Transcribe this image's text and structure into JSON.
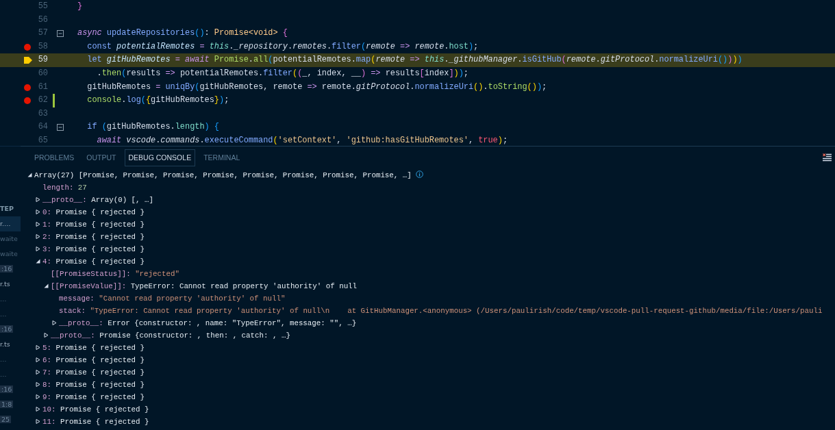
{
  "editor": {
    "lines": [
      {
        "number": "55",
        "breakpoint": false,
        "current_frame": false,
        "modified": false,
        "code": [
          {
            "text": "}",
            "kind": "b2"
          }
        ]
      },
      {
        "number": "56",
        "breakpoint": false,
        "current_frame": false,
        "modified": false
      },
      {
        "number": "57",
        "breakpoint": false,
        "current_frame": false,
        "modified": false,
        "fold": true,
        "code": [
          {
            "text": "async ",
            "kind": "kw"
          },
          {
            "text": "updateRepositories",
            "kind": "fn"
          },
          {
            "text": "()",
            "kind": "b3"
          },
          {
            "text": ": ",
            "kind": "plain"
          },
          {
            "text": "Promise<void> ",
            "kind": "type"
          },
          {
            "text": "{",
            "kind": "b2"
          }
        ]
      },
      {
        "number": "58",
        "breakpoint": true,
        "current_frame": false,
        "modified": false,
        "code": [
          {
            "text": "  const ",
            "kind": "decl"
          },
          {
            "text": "potentialRemotes",
            "kind": "var"
          },
          {
            "text": " = ",
            "kind": "op"
          },
          {
            "text": "this",
            "kind": "this"
          },
          {
            "text": ".",
            "kind": "plain"
          },
          {
            "text": "_repository",
            "kind": "prop"
          },
          {
            "text": ".",
            "kind": "plain"
          },
          {
            "text": "remotes",
            "kind": "prop"
          },
          {
            "text": ".",
            "kind": "plain"
          },
          {
            "text": "filter",
            "kind": "fn"
          },
          {
            "text": "(",
            "kind": "b3"
          },
          {
            "text": "remote",
            "kind": "prop"
          },
          {
            "text": " => ",
            "kind": "op"
          },
          {
            "text": "remote",
            "kind": "prop"
          },
          {
            "text": ".",
            "kind": "plain"
          },
          {
            "text": "host",
            "kind": "teal"
          },
          {
            "text": ")",
            "kind": "b3"
          },
          {
            "text": ";",
            "kind": "plain"
          }
        ]
      },
      {
        "number": "59",
        "breakpoint": false,
        "current_frame": true,
        "modified": false,
        "code": [
          {
            "text": "  let ",
            "kind": "decl"
          },
          {
            "text": "gitHubRemotes",
            "kind": "var"
          },
          {
            "text": " = ",
            "kind": "op"
          },
          {
            "text": "await ",
            "kind": "kw"
          },
          {
            "text": "Promise",
            "kind": "green"
          },
          {
            "text": ".",
            "kind": "plain"
          },
          {
            "text": "all",
            "kind": "green"
          },
          {
            "text": "(",
            "kind": "b3"
          },
          {
            "text": "potentialRemotes.",
            "kind": "plain"
          },
          {
            "text": "map",
            "kind": "fn"
          },
          {
            "text": "(",
            "kind": "b1"
          },
          {
            "text": "remote",
            "kind": "prop"
          },
          {
            "text": " => ",
            "kind": "op"
          },
          {
            "text": "this",
            "kind": "this"
          },
          {
            "text": ".",
            "kind": "plain"
          },
          {
            "text": "_githubManager",
            "kind": "prop"
          },
          {
            "text": ".",
            "kind": "plain"
          },
          {
            "text": "isGitHub",
            "kind": "fn"
          },
          {
            "text": "(",
            "kind": "b2"
          },
          {
            "text": "remote",
            "kind": "prop"
          },
          {
            "text": ".",
            "kind": "plain"
          },
          {
            "text": "gitProtocol",
            "kind": "prop"
          },
          {
            "text": ".",
            "kind": "plain"
          },
          {
            "text": "normalizeUri",
            "kind": "fn"
          },
          {
            "text": "()",
            "kind": "b3"
          },
          {
            "text": ")",
            "kind": "b2"
          },
          {
            "text": ")",
            "kind": "b1"
          },
          {
            "text": ")",
            "kind": "b3"
          }
        ]
      },
      {
        "number": "60",
        "breakpoint": false,
        "current_frame": false,
        "modified": false,
        "code": [
          {
            "text": "    .",
            "kind": "plain"
          },
          {
            "text": "then",
            "kind": "green"
          },
          {
            "text": "(",
            "kind": "b3"
          },
          {
            "text": "results",
            "kind": "plain"
          },
          {
            "text": " => ",
            "kind": "op"
          },
          {
            "text": "potentialRemotes.",
            "kind": "plain"
          },
          {
            "text": "filter",
            "kind": "fn"
          },
          {
            "text": "(",
            "kind": "b1"
          },
          {
            "text": "(",
            "kind": "b2"
          },
          {
            "text": "_, index, __",
            "kind": "plain"
          },
          {
            "text": ")",
            "kind": "b2"
          },
          {
            "text": " => ",
            "kind": "op"
          },
          {
            "text": "results",
            "kind": "plain"
          },
          {
            "text": "[",
            "kind": "b2"
          },
          {
            "text": "index",
            "kind": "plain"
          },
          {
            "text": "]",
            "kind": "b2"
          },
          {
            "text": ")",
            "kind": "b1"
          },
          {
            "text": ")",
            "kind": "b3"
          },
          {
            "text": ";",
            "kind": "plain"
          }
        ]
      },
      {
        "number": "61",
        "breakpoint": true,
        "current_frame": false,
        "modified": false,
        "code": [
          {
            "text": "  gitHubRemotes",
            "kind": "plain"
          },
          {
            "text": " = ",
            "kind": "op"
          },
          {
            "text": "uniqBy",
            "kind": "fn"
          },
          {
            "text": "(",
            "kind": "b3"
          },
          {
            "text": "gitHubRemotes, remote",
            "kind": "plain"
          },
          {
            "text": " => ",
            "kind": "op"
          },
          {
            "text": "remote.",
            "kind": "plain"
          },
          {
            "text": "gitProtocol",
            "kind": "prop"
          },
          {
            "text": ".",
            "kind": "plain"
          },
          {
            "text": "normalizeUri",
            "kind": "fn"
          },
          {
            "text": "()",
            "kind": "b1"
          },
          {
            "text": ".",
            "kind": "plain"
          },
          {
            "text": "toString",
            "kind": "green"
          },
          {
            "text": "()",
            "kind": "b1"
          },
          {
            "text": ")",
            "kind": "b3"
          },
          {
            "text": ";",
            "kind": "plain"
          }
        ]
      },
      {
        "number": "62",
        "breakpoint": true,
        "current_frame": false,
        "modified": true,
        "code": [
          {
            "text": "  console",
            "kind": "green"
          },
          {
            "text": ".",
            "kind": "plain"
          },
          {
            "text": "log",
            "kind": "fn"
          },
          {
            "text": "(",
            "kind": "b3"
          },
          {
            "text": "{",
            "kind": "b1"
          },
          {
            "text": "gitHubRemotes",
            "kind": "plain"
          },
          {
            "text": "}",
            "kind": "b1"
          },
          {
            "text": ")",
            "kind": "b3"
          },
          {
            "text": ";",
            "kind": "plain"
          }
        ]
      },
      {
        "number": "63",
        "breakpoint": false,
        "current_frame": false,
        "modified": false
      },
      {
        "number": "64",
        "breakpoint": false,
        "current_frame": false,
        "modified": false,
        "fold": true,
        "code": [
          {
            "text": "  if ",
            "kind": "decl"
          },
          {
            "text": "(",
            "kind": "b3"
          },
          {
            "text": "gitHubRemotes.",
            "kind": "plain"
          },
          {
            "text": "length",
            "kind": "teal"
          },
          {
            "text": ") ",
            "kind": "b3"
          },
          {
            "text": "{",
            "kind": "b3"
          }
        ]
      },
      {
        "number": "65",
        "breakpoint": false,
        "current_frame": false,
        "modified": false,
        "code": [
          {
            "text": "    await ",
            "kind": "kw"
          },
          {
            "text": "vscode",
            "kind": "prop"
          },
          {
            "text": ".",
            "kind": "plain"
          },
          {
            "text": "commands",
            "kind": "prop"
          },
          {
            "text": ".",
            "kind": "plain"
          },
          {
            "text": "executeCommand",
            "kind": "fn"
          },
          {
            "text": "(",
            "kind": "b1"
          },
          {
            "text": "'setContext'",
            "kind": "str"
          },
          {
            "text": ", ",
            "kind": "plain"
          },
          {
            "text": "'github:hasGitHubRemotes'",
            "kind": "str"
          },
          {
            "text": ", ",
            "kind": "plain"
          },
          {
            "text": "true",
            "kind": "bool"
          },
          {
            "text": ")",
            "kind": "b1"
          },
          {
            "text": ";",
            "kind": "plain"
          }
        ]
      }
    ]
  },
  "sidebar": {
    "items": [
      {
        "text": "TEP",
        "kind": "header",
        "selected": false
      },
      {
        "text": "r.…",
        "kind": "text",
        "selected": true
      },
      {
        "text": "waite",
        "kind": "dim",
        "selected": false
      },
      {
        "text": "waite",
        "kind": "dim",
        "selected": false
      },
      {
        "text": ":16",
        "kind": "badge",
        "selected": false
      },
      {
        "text": "r.ts",
        "kind": "text",
        "selected": false
      },
      {
        "text": "…",
        "kind": "dim",
        "selected": false
      },
      {
        "text": "…",
        "kind": "dim",
        "selected": false
      },
      {
        "text": ":16",
        "kind": "badge",
        "selected": false
      },
      {
        "text": "r.ts",
        "kind": "text",
        "selected": false
      },
      {
        "text": "…",
        "kind": "dim",
        "selected": false
      },
      {
        "text": "…",
        "kind": "dim",
        "selected": false
      },
      {
        "text": ":16",
        "kind": "badge",
        "selected": false
      },
      {
        "text": "1:8",
        "kind": "badge",
        "selected": false
      },
      {
        "text": "25",
        "kind": "badge",
        "selected": false
      }
    ]
  },
  "panel": {
    "tabs": [
      {
        "label": "PROBLEMS",
        "selected": false
      },
      {
        "label": "OUTPUT",
        "selected": false
      },
      {
        "label": "DEBUG CONSOLE",
        "selected": true
      },
      {
        "label": "TERMINAL",
        "selected": false
      }
    ],
    "console": [
      {
        "value": "Array(27) [Promise, Promise, Promise, Promise, Promise, Promise, Promise, Promise, …]",
        "kind": "object",
        "expanded": true,
        "info": true,
        "children": [
          {
            "key": "length:",
            "value": "27",
            "kind": "number"
          },
          {
            "key": "__proto__:",
            "value": "Array(0) [, …]",
            "kind": "object",
            "expanded": false
          },
          {
            "key": "0:",
            "value": "Promise { rejected }",
            "kind": "object",
            "expanded": false
          },
          {
            "key": "1:",
            "value": "Promise { rejected }",
            "kind": "object",
            "expanded": false
          },
          {
            "key": "2:",
            "value": "Promise { rejected }",
            "kind": "object",
            "expanded": false
          },
          {
            "key": "3:",
            "value": "Promise { rejected }",
            "kind": "object",
            "expanded": false
          },
          {
            "key": "4:",
            "value": "Promise { rejected }",
            "kind": "object",
            "expanded": true,
            "children": [
              {
                "key": "[[PromiseStatus]]:",
                "value": "\"rejected\"",
                "kind": "string"
              },
              {
                "key": "[[PromiseValue]]:",
                "value": "TypeError: Cannot read property 'authority' of null",
                "kind": "object",
                "expanded": true,
                "children": [
                  {
                    "key": "message:",
                    "value": "\"Cannot read property 'authority' of null\"",
                    "kind": "string"
                  },
                  {
                    "key": "stack:",
                    "value": "\"TypeError: Cannot read property 'authority' of null\\n    at GitHubManager.<anonymous> (/Users/paulirish/code/temp/vscode-pull-request-github/media/file:/Users/pauli",
                    "kind": "string"
                  },
                  {
                    "key": "__proto__:",
                    "value": "Error {constructor: , name: \"TypeError\", message: \"\", …}",
                    "kind": "object",
                    "expanded": false
                  }
                ]
              },
              {
                "key": "__proto__:",
                "value": "Promise {constructor: , then: , catch: , …}",
                "kind": "object",
                "expanded": false
              }
            ]
          },
          {
            "key": "5:",
            "value": "Promise { rejected }",
            "kind": "object",
            "expanded": false
          },
          {
            "key": "6:",
            "value": "Promise { rejected }",
            "kind": "object",
            "expanded": false
          },
          {
            "key": "7:",
            "value": "Promise { rejected }",
            "kind": "object",
            "expanded": false
          },
          {
            "key": "8:",
            "value": "Promise { rejected }",
            "kind": "object",
            "expanded": false
          },
          {
            "key": "9:",
            "value": "Promise { rejected }",
            "kind": "object",
            "expanded": false
          },
          {
            "key": "10:",
            "value": "Promise { rejected }",
            "kind": "object",
            "expanded": false
          },
          {
            "key": "11:",
            "value": "Promise { rejected }",
            "kind": "object",
            "expanded": false
          }
        ]
      }
    ]
  }
}
